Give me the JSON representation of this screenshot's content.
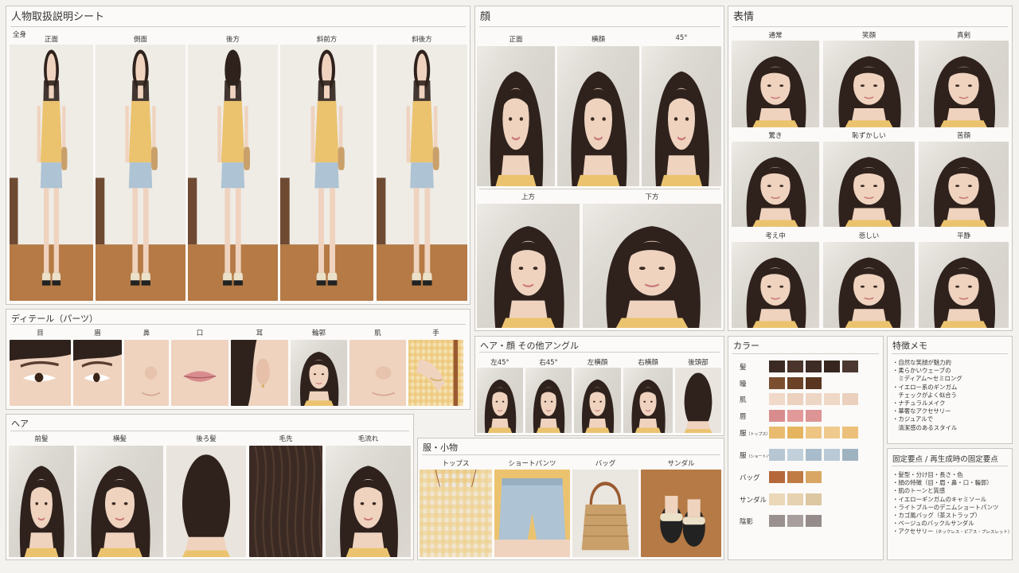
{
  "sheet_title": "人物取扱説明シート",
  "full_body": {
    "subtitle": "全身",
    "labels": [
      "正面",
      "側面",
      "後方",
      "斜前方",
      "斜後方"
    ]
  },
  "face": {
    "title": "顔",
    "top_labels": [
      "正面",
      "横顔",
      "45°"
    ],
    "bottom_labels": [
      "上方",
      "下方"
    ]
  },
  "expression": {
    "title": "表情",
    "labels": [
      "通常",
      "笑顔",
      "真剣",
      "驚き",
      "恥ずかしい",
      "苦顔",
      "考え中",
      "悲しい",
      "平静"
    ]
  },
  "detail": {
    "title": "ディテール（パーツ）",
    "labels": [
      "目",
      "眉",
      "鼻",
      "口",
      "耳",
      "輪郭",
      "肌",
      "手"
    ]
  },
  "hair_face_angles": {
    "title": "ヘア・顔 その他アングル",
    "labels": [
      "左45°",
      "右45°",
      "左横顔",
      "右横顔",
      "後頭部"
    ]
  },
  "hair": {
    "title": "ヘア",
    "labels": [
      "前髪",
      "横髪",
      "後ろ髪",
      "毛先",
      "毛流れ"
    ]
  },
  "clothes": {
    "title": "服・小物",
    "labels": [
      "トップス",
      "ショートパンツ",
      "バッグ",
      "サンダル"
    ]
  },
  "colors": {
    "title": "カラー",
    "rows": [
      {
        "label": "髪",
        "note": "",
        "swatches": [
          "#3b2a24",
          "#4a342b",
          "#3d2b25",
          "#36261f",
          "#4b3830"
        ]
      },
      {
        "label": "瞳",
        "note": "",
        "swatches": [
          "#7a4e2f",
          "#6b4228",
          "#5a3620"
        ]
      },
      {
        "label": "肌",
        "note": "",
        "swatches": [
          "#f1d9c9",
          "#ecd1bf",
          "#eed6c5",
          "#f0d8c6",
          "#ead0bd"
        ]
      },
      {
        "label": "唇",
        "note": "",
        "swatches": [
          "#d98c8d",
          "#e2999a",
          "#dd9494"
        ]
      },
      {
        "label": "服",
        "note": "（トップス）",
        "swatches": [
          "#e9bb6e",
          "#e6b45f",
          "#eec583",
          "#f0ca8d",
          "#ecc07a"
        ]
      },
      {
        "label": "服",
        "note": "（ショートパンツ）",
        "swatches": [
          "#b6c7d3",
          "#c1d0db",
          "#a9bccb",
          "#b9cad6",
          "#9fb2c0"
        ]
      },
      {
        "label": "バッグ",
        "note": "",
        "swatches": [
          "#b5683a",
          "#c07a44",
          "#d9a763"
        ]
      },
      {
        "label": "サンダル",
        "note": "",
        "swatches": [
          "#ead8b8",
          "#e6d1b0",
          "#ddc7a2"
        ]
      },
      {
        "label": "陰影",
        "note": "",
        "swatches": [
          "#9a9090",
          "#a79e9d",
          "#958b8b"
        ]
      }
    ]
  },
  "features": {
    "title": "特徴メモ",
    "lines": [
      "・自然な笑顔が魅力的",
      "・柔らかいウェーブの",
      "　ミディアム〜セミロング",
      "・イエロー系のギンガム",
      "　チェックがよく似合う",
      "・ナチュラルメイク",
      "・華奢なアクセサリー",
      "・カジュアルで",
      "　清潔感のあるスタイル"
    ]
  },
  "fixed_points": {
    "title": "固定要点 / 再生成時の固定要点",
    "lines": [
      "・髪型・分け目・長さ・色",
      "・顔の特徴（目・眉・鼻・口・輪郭）",
      "・肌のトーンと質感",
      "・イエローギンガムのキャミソール",
      "・ライトブルーのデニムショートパンツ",
      "・カゴ風バッグ（茶ストラップ）",
      "・ベージュのバックルサンダル"
    ],
    "last_line_main": "・アクセサリー",
    "last_line_note": "（ネックレス・ピアス・ブレスレット）"
  },
  "palette": {
    "hair": "#2f221d",
    "skin": "#efd3bf",
    "gingham": "#ebc36f",
    "denim": "#aec3d3",
    "wall": "#efece6",
    "floor": "#b57a45",
    "sandal": "#ebe0c8",
    "bag": "#c9a06a",
    "strap": "#9a5a30"
  }
}
